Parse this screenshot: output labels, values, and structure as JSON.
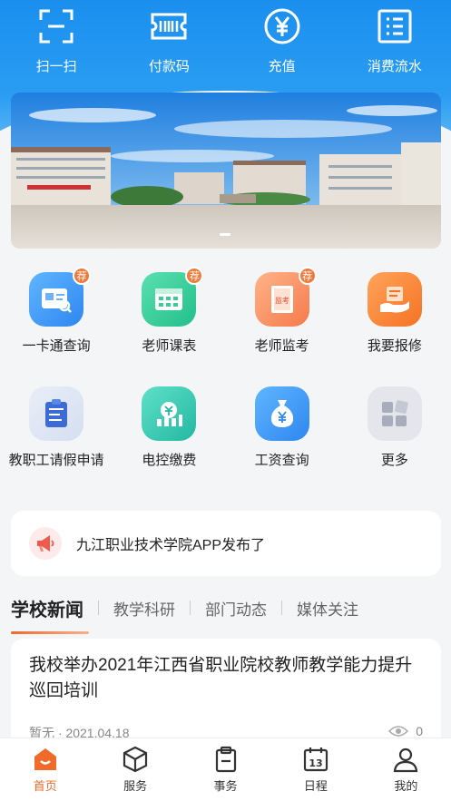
{
  "quick_actions": [
    {
      "label": "扫一扫",
      "icon": "scan-icon"
    },
    {
      "label": "付款码",
      "icon": "payment-code-icon"
    },
    {
      "label": "充值",
      "icon": "yuan-icon"
    },
    {
      "label": "消费流水",
      "icon": "list-icon"
    }
  ],
  "banner": {
    "icon": "campus-photo"
  },
  "services": [
    {
      "label": "一卡通查询",
      "badge": "荐",
      "icon": "id-card-icon"
    },
    {
      "label": "老师课表",
      "badge": "荐",
      "icon": "calendar-icon"
    },
    {
      "label": "老师监考",
      "badge": "荐",
      "icon": "exam-icon",
      "inner": "监考"
    },
    {
      "label": "我要报修",
      "badge": "",
      "icon": "repair-icon"
    },
    {
      "label": "教职工请假申请",
      "badge": "",
      "icon": "leave-icon"
    },
    {
      "label": "电控缴费",
      "badge": "",
      "icon": "electricity-icon"
    },
    {
      "label": "工资查询",
      "badge": "",
      "icon": "salary-icon"
    },
    {
      "label": "更多",
      "badge": "",
      "icon": "more-icon"
    }
  ],
  "notice": {
    "text": "九江职业技术学院APP发布了",
    "icon": "megaphone-icon"
  },
  "news_tabs": [
    "学校新闻",
    "教学科研",
    "部门动态",
    "媒体关注"
  ],
  "article": {
    "title": "我校举办2021年江西省职业院校教师教学能力提升巡回培训",
    "meta": "暂无 · 2021.04.18",
    "views": "0"
  },
  "tabbar": [
    {
      "label": "首页",
      "icon": "home-icon"
    },
    {
      "label": "服务",
      "icon": "box-icon"
    },
    {
      "label": "事务",
      "icon": "clipboard-icon"
    },
    {
      "label": "日程",
      "icon": "calendar-13-icon",
      "day": "13"
    },
    {
      "label": "我的",
      "icon": "user-icon"
    }
  ],
  "colors": {
    "primary": "#1a8fee",
    "accent": "#f06a2a"
  }
}
